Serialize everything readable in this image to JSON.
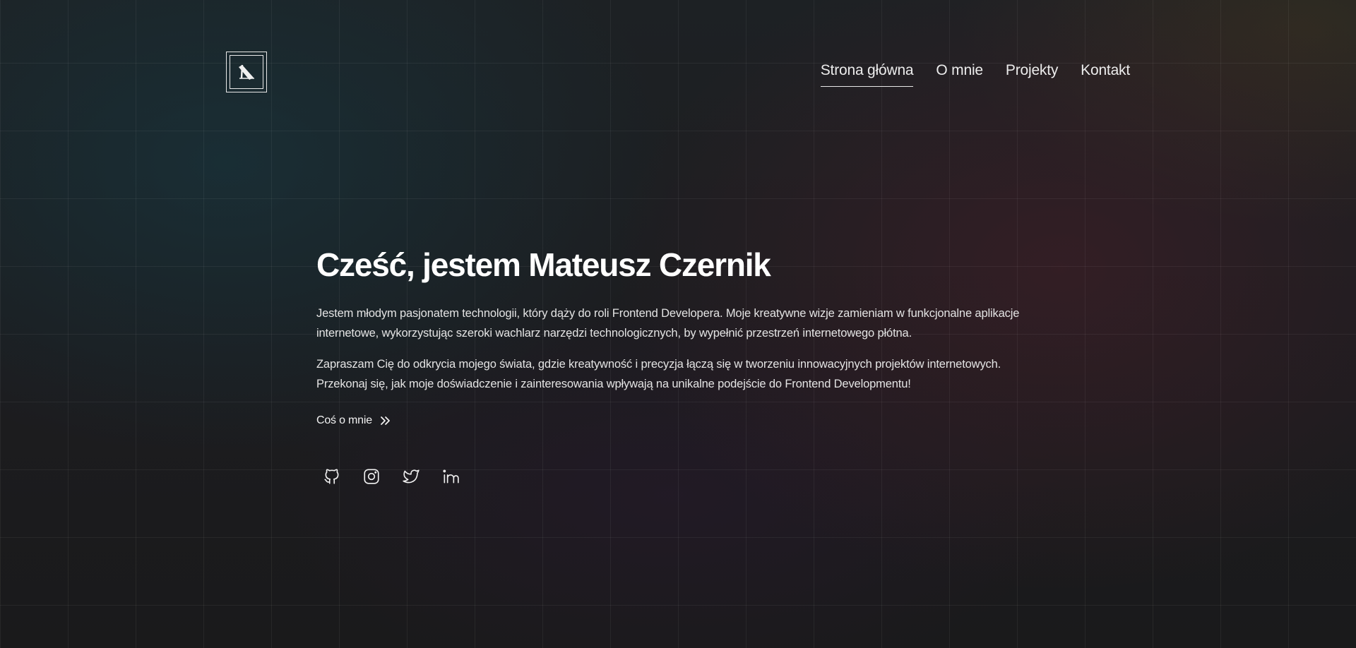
{
  "nav": {
    "items": [
      {
        "label": "Strona główna",
        "active": true
      },
      {
        "label": "O mnie",
        "active": false
      },
      {
        "label": "Projekty",
        "active": false
      },
      {
        "label": "Kontakt",
        "active": false
      }
    ]
  },
  "hero": {
    "title": "Cześć, jestem Mateusz Czernik",
    "paragraph_1": "Jestem młodym pasjonatem technologii, który dąży do roli Frontend Developera. Moje kreatywne wizje zamieniam w funkcjonalne aplikacje internetowe, wykorzystując szeroki wachlarz narzędzi technologicznych, by wypełnić przestrzeń internetowego płótna.",
    "paragraph_2": "Zapraszam Cię do odkrycia mojego świata, gdzie kreatywność i precyzja łączą się w tworzeniu innowacyjnych projektów internetowych. Przekonaj się, jak moje doświadczenie i zainteresowania wpływają na unikalne podejście do Frontend Developmentu!",
    "more_label": "Coś o mnie",
    "more_icon": "double-chevron-right-icon"
  },
  "socials": [
    {
      "icon": "github-icon"
    },
    {
      "icon": "instagram-icon"
    },
    {
      "icon": "twitter-icon"
    },
    {
      "icon": "linkedin-icon"
    }
  ],
  "colors": {
    "text": "#f2f2f2",
    "heading": "#ffffff",
    "background": "#1b1b1d"
  }
}
